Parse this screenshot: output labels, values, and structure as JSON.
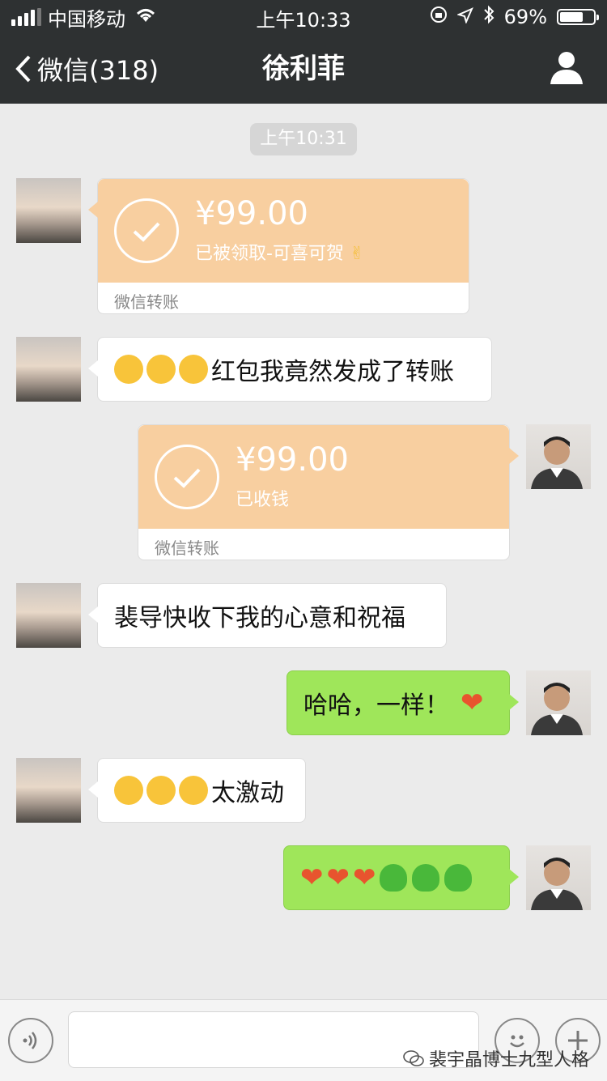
{
  "status_bar": {
    "carrier": "中国移动",
    "time": "上午10:33",
    "battery": "69%",
    "battery_level": 0.69
  },
  "nav": {
    "back_label": "微信(318)",
    "title": "徐利菲"
  },
  "chat": {
    "timestamp": "上午10:31",
    "messages": [
      {
        "amount": "¥99.00",
        "status": "已被领取-可喜可贺",
        "footer": "微信转账"
      },
      {
        "text": "红包我竟然发成了转账"
      },
      {
        "amount": "¥99.00",
        "status": "已收钱",
        "footer": "微信转账"
      },
      {
        "text": "裴导快收下我的心意和祝福"
      },
      {
        "text": "哈哈，一样！"
      },
      {
        "text": "太激动"
      }
    ]
  },
  "watermark": "裴宇晶博士九型人格",
  "colors": {
    "nav_bg": "#2e3132",
    "chat_bg": "#ebebeb",
    "transfer_peach": "#f8cfa0",
    "bubble_green": "#9fe65a",
    "bubble_white": "#ffffff"
  }
}
